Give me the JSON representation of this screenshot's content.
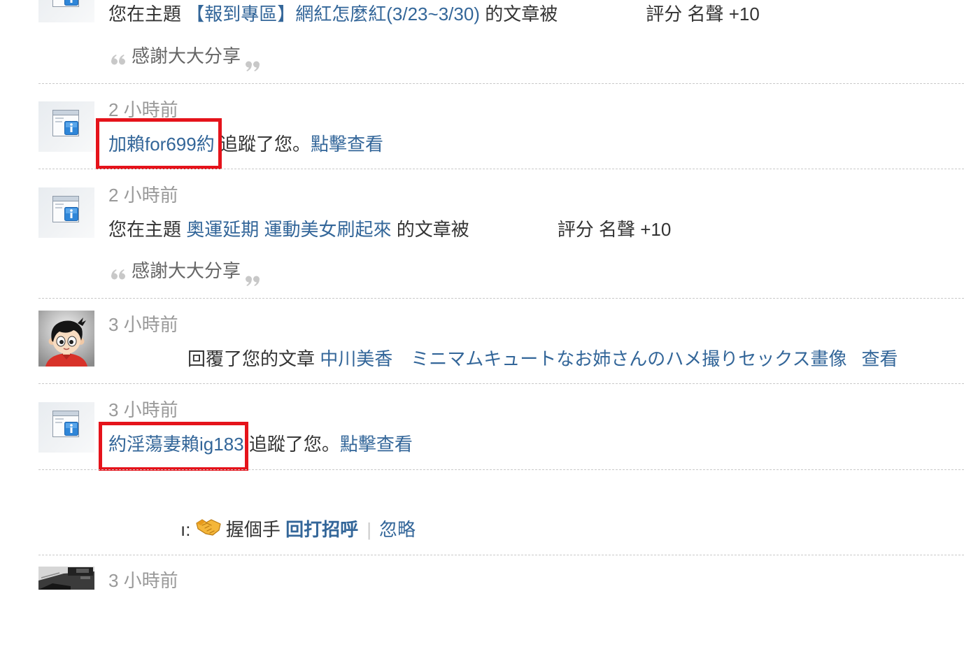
{
  "notices": [
    {
      "icon": "system-notice-icon",
      "prefix": "您在主題",
      "thread_title": "【報到專區】網紅怎麼紅(3/23~3/30)",
      "suffix": "的文章被",
      "rating_label": "評分",
      "rating_type": "名聲",
      "rating_value": "+10",
      "quote": "感謝大大分享"
    },
    {
      "time": "2 小時前",
      "icon": "system-notice-icon",
      "user": "加賴for699約",
      "action": "追蹤了您。",
      "link": "點擊查看",
      "highlighted": true
    },
    {
      "time": "2 小時前",
      "icon": "system-notice-icon",
      "prefix": "您在主題",
      "thread_title": "奧運延期 運動美女刷起來",
      "suffix": "的文章被",
      "rating_label": "評分",
      "rating_type": "名聲",
      "rating_value": "+10",
      "quote": "感謝大大分享"
    },
    {
      "time": "3 小時前",
      "icon": "user-avatar",
      "action": "回覆了您的文章",
      "thread_title": "中川美香　ミニマムキュートなお姉さんのハメ撮りセックス畫像",
      "link": "查看"
    },
    {
      "time": "3 小時前",
      "icon": "system-notice-icon",
      "user": "約淫蕩妻賴ig183",
      "action": "追蹤了您。",
      "link": "點擊查看",
      "highlighted": true
    },
    {
      "fragment": "ı:",
      "icon": "handshake-icon",
      "poke_text": "握個手",
      "reply_link": "回打招呼",
      "separator": "|",
      "ignore_link": "忽略"
    },
    {
      "time": "3 小時前",
      "icon": "user-avatar"
    }
  ],
  "colors": {
    "link": "#336699",
    "text": "#333333",
    "muted": "#999999",
    "highlight_box": "#e5131b",
    "divider": "#cccccc"
  }
}
